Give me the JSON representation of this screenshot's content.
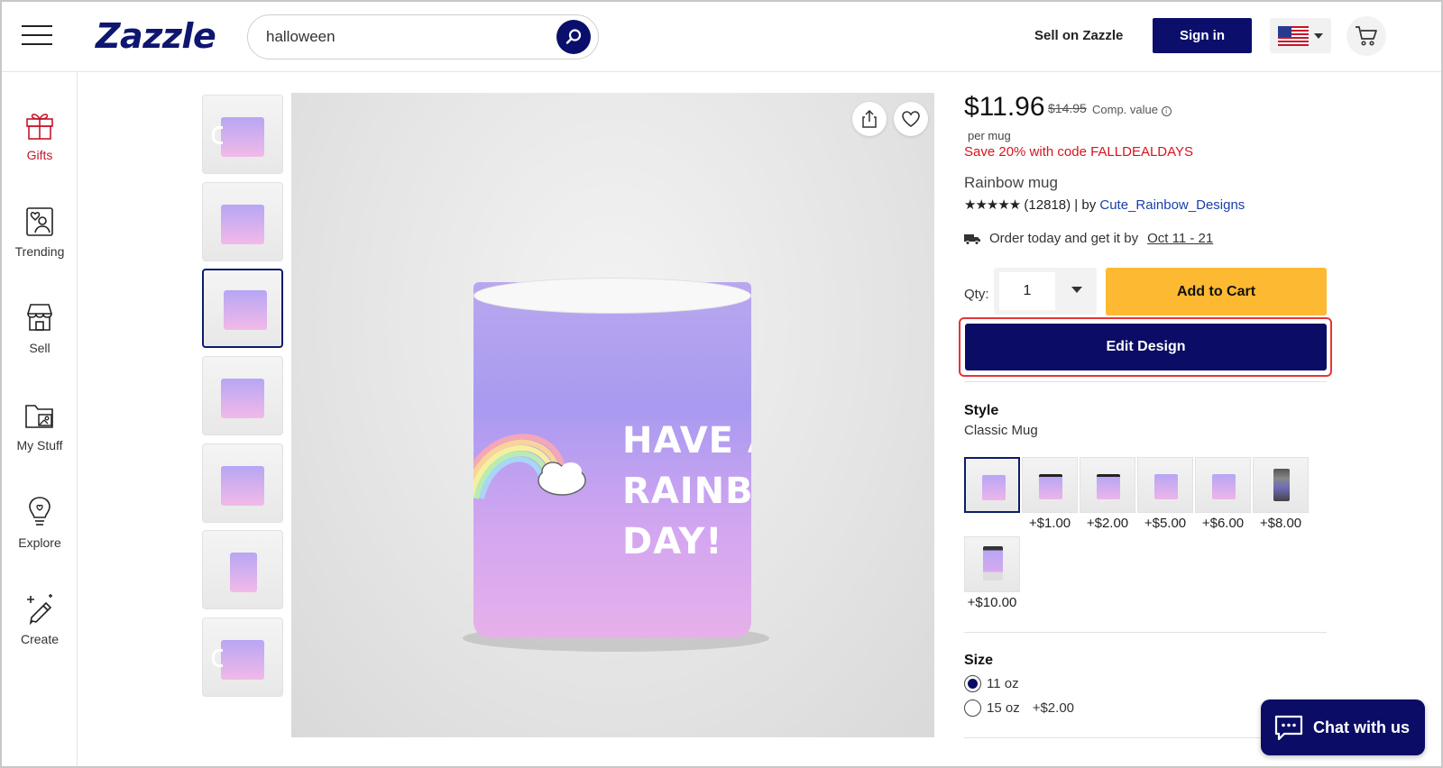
{
  "header": {
    "logo": "Zazzle",
    "search_value": "halloween",
    "sell_link": "Sell on Zazzle",
    "signin_label": "Sign in",
    "flag_icon": "us-flag-icon",
    "cart_icon": "cart-icon"
  },
  "leftnav": {
    "items": [
      {
        "label": "Gifts",
        "icon": "gift-icon"
      },
      {
        "label": "Trending",
        "icon": "trending-heart-icon"
      },
      {
        "label": "Sell",
        "icon": "store-icon"
      },
      {
        "label": "My Stuff",
        "icon": "folder-image-icon"
      },
      {
        "label": "Explore",
        "icon": "lightbulb-icon"
      },
      {
        "label": "Create",
        "icon": "magic-pen-icon"
      }
    ]
  },
  "gallery": {
    "thumb_count": 7,
    "selected_thumb": 3,
    "mug_text_line1": "HAVE A",
    "mug_text_line2": "RAINBOW",
    "mug_text_line3": "DAY!"
  },
  "product": {
    "price": "$11.96",
    "old_price": "$14.95",
    "comp_value": "Comp. value",
    "per_unit": "per mug",
    "promo": "Save 20% with code FALLDEALDAYS",
    "name": "Rainbow mug",
    "stars": "★★★★★",
    "review_count": "(12818)",
    "by_text": "| by",
    "seller": "Cute_Rainbow_Designs",
    "shipping_text": "Order today and get it by",
    "shipping_date": "Oct 11 - 21",
    "qty_label": "Qty:",
    "qty_value": "1",
    "add_to_cart": "Add to Cart",
    "edit_design": "Edit Design"
  },
  "style_section": {
    "title": "Style",
    "selected": "Classic Mug",
    "options": [
      "",
      "+$1.00",
      "+$2.00",
      "+$5.00",
      "+$6.00",
      "+$8.00",
      "+$10.00"
    ]
  },
  "size_section": {
    "title": "Size",
    "options": [
      {
        "label": "11 oz",
        "extra": ""
      },
      {
        "label": "15 oz",
        "extra": "+$2.00"
      }
    ],
    "selected": "11 oz"
  },
  "chat": {
    "label": "Chat with us"
  },
  "colors": {
    "brand_navy": "#0b0c65",
    "cart_yellow": "#fdb931",
    "promo_red": "#d8141f",
    "link_blue": "#1a3fa8"
  }
}
